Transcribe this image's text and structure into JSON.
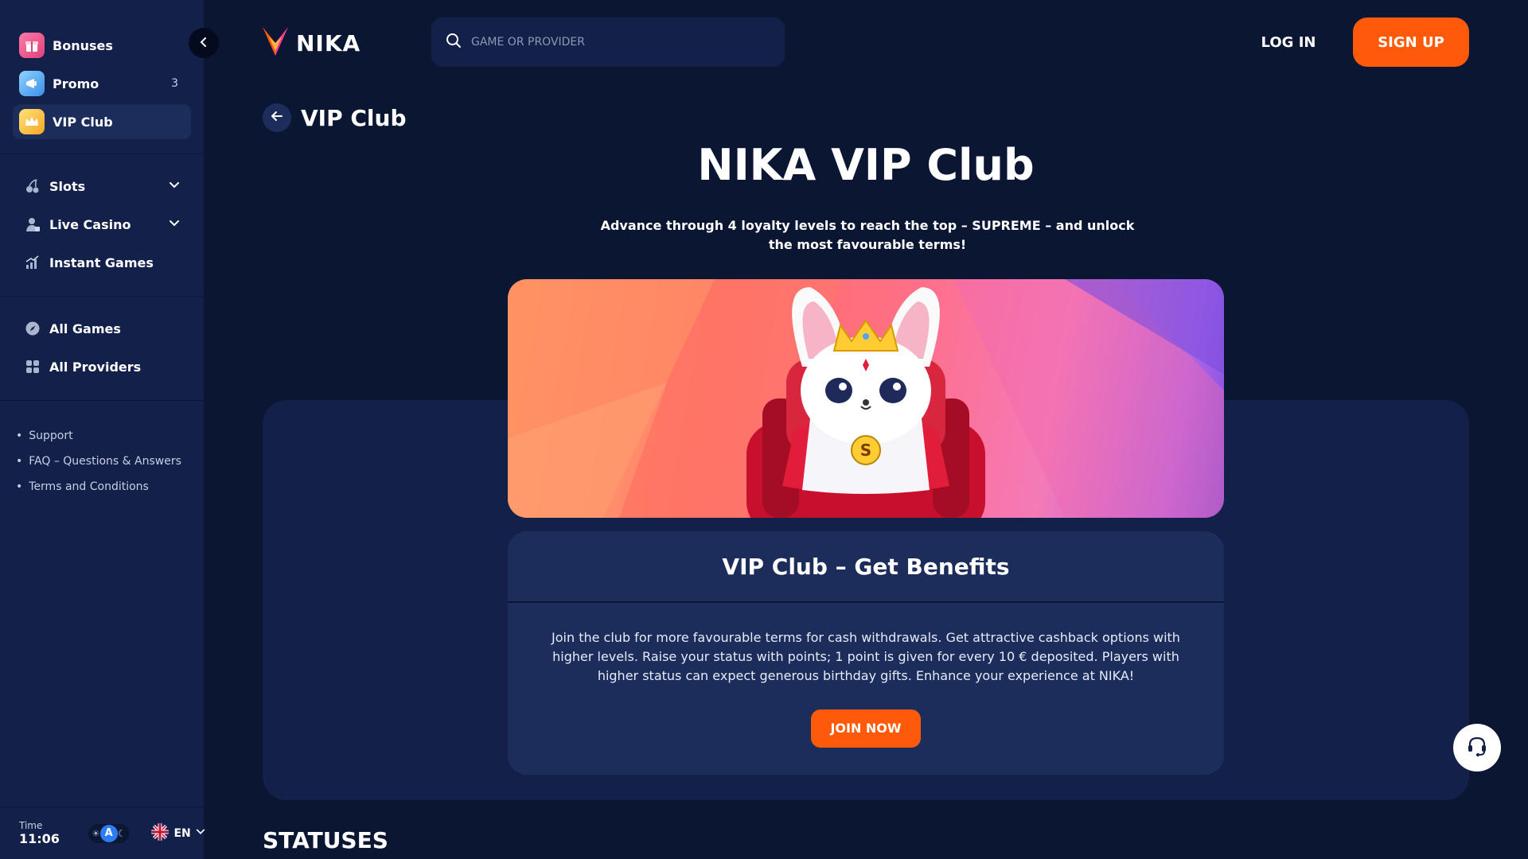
{
  "app": {
    "name": "NIKA"
  },
  "sidebar": {
    "promo_items": [
      {
        "label": "Bonuses",
        "icon": "gift-icon"
      },
      {
        "label": "Promo",
        "icon": "megaphone-icon",
        "count": "3"
      },
      {
        "label": "VIP Club",
        "icon": "crown-icon",
        "active": true
      }
    ],
    "game_nav": [
      {
        "label": "Slots",
        "icon": "cherry-icon",
        "expandable": true
      },
      {
        "label": "Live Casino",
        "icon": "dealer-icon",
        "expandable": true
      },
      {
        "label": "Instant Games",
        "icon": "chart-bars-icon"
      }
    ],
    "catalog_nav": [
      {
        "label": "All Games",
        "icon": "compass-icon"
      },
      {
        "label": "All Providers",
        "icon": "grid-icon"
      }
    ],
    "help_links": [
      "Support",
      "FAQ – Questions & Answers",
      "Terms and Conditions"
    ],
    "time_label": "Time",
    "time_value": "11:06",
    "theme_mode": "A",
    "language": "EN"
  },
  "header": {
    "search_placeholder": "GAME OR PROVIDER",
    "login_label": "LOG IN",
    "signup_label": "SIGN UP"
  },
  "page": {
    "breadcrumb_title": "VIP Club",
    "hero_title": "NIKA VIP Club",
    "hero_subtitle": "Advance through 4 loyalty levels to reach the top – SUPREME – and unlock the most favourable terms!",
    "info_title": "VIP Club – Get Benefits",
    "info_text": "Join the club for more favourable terms for cash withdrawals. Get attractive cashback options with higher levels. Raise your status with points; 1 point is given for every 10 € deposited. Players with higher status can expect generous birthday gifts. Enhance your experience at NIKA!",
    "join_label": "JOIN NOW",
    "statuses_heading": "STATUSES",
    "mascot_letter": "S"
  },
  "colors": {
    "accent": "#ff5a0a",
    "background": "#0b1633",
    "panel": "#13214a",
    "card": "#1c2d5c"
  }
}
